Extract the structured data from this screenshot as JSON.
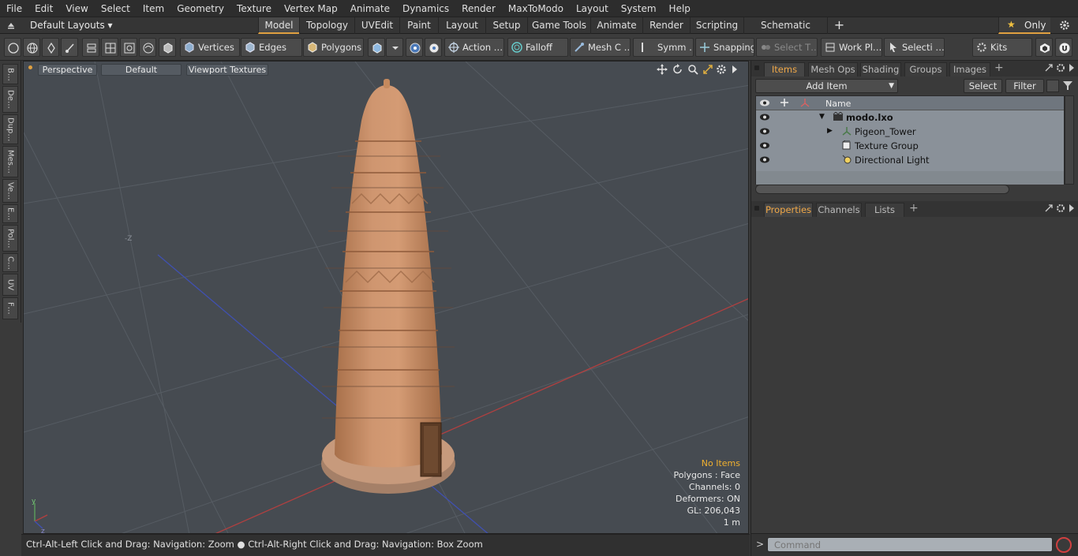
{
  "menu": [
    "File",
    "Edit",
    "View",
    "Select",
    "Item",
    "Geometry",
    "Texture",
    "Vertex Map",
    "Animate",
    "Dynamics",
    "Render",
    "MaxToModo",
    "Layout",
    "System",
    "Help"
  ],
  "layout_bar": {
    "preset": "Default Layouts ▾",
    "tabs": [
      "Model",
      "Topology",
      "UVEdit",
      "Paint",
      "Layout",
      "Setup",
      "Game Tools",
      "Animate",
      "Render",
      "Scripting",
      "Schematic Fusion"
    ],
    "active_tab": "Model",
    "add_label": "+",
    "only_label": "Only"
  },
  "toolbar": {
    "vertices": "Vertices",
    "edges": "Edges",
    "polygons": "Polygons",
    "action": "Action …",
    "falloff": "Falloff",
    "mesh_c": "Mesh C …",
    "symm": "Symm …",
    "snapping": "Snapping",
    "select_t": "Select T…",
    "work_pl": "Work Pl…",
    "selecti": "Selecti …",
    "kits": "Kits"
  },
  "left_tabs": [
    "B…",
    "De…",
    "Dup…",
    "Mes…",
    "Ve…",
    "E…",
    "Pol…",
    "C…",
    "UV",
    "F…"
  ],
  "viewport": {
    "view_mode": "Perspective",
    "shading": "Default",
    "textures": "Viewport Textures",
    "axis_hint": "-Z",
    "info": {
      "no_items": "No Items",
      "polygons": "Polygons : Face",
      "channels": "Channels: 0",
      "deformers": "Deformers: ON",
      "gl": "GL: 206,043",
      "scale": "1 m"
    },
    "accent_color": "#f0b030"
  },
  "status_text": "Ctrl-Alt-Left Click and Drag: Navigation: Zoom ● Ctrl-Alt-Right Click and Drag: Navigation: Box Zoom",
  "items_panel": {
    "tabs": [
      "Items",
      "Mesh Ops",
      "Shading",
      "Groups",
      "Images"
    ],
    "active_tab": "Items",
    "add_item": "Add Item",
    "select_btn": "Select",
    "filter_btn": "Filter",
    "column_name": "Name",
    "rows": [
      {
        "name": "modo.lxo",
        "icon": "scene-icon"
      },
      {
        "name": "Pigeon_Tower",
        "icon": "mesh-locator-icon"
      },
      {
        "name": "Texture Group",
        "icon": "texture-group-icon"
      },
      {
        "name": "Directional Light",
        "icon": "light-icon"
      }
    ]
  },
  "properties_panel": {
    "tabs": [
      "Properties",
      "Channels",
      "Lists"
    ],
    "active_tab": "Properties"
  },
  "command": {
    "prompt": ">",
    "placeholder": "Command"
  }
}
